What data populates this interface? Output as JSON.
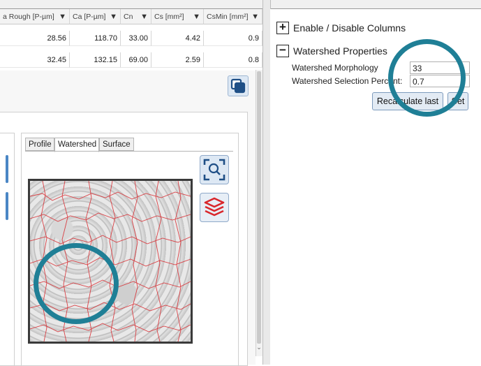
{
  "table": {
    "columns": [
      {
        "label": "a Rough [P-µm]"
      },
      {
        "label": "Ca [P-µm]"
      },
      {
        "label": "Cn"
      },
      {
        "label": "Cs [mm²]"
      },
      {
        "label": "CsMin [mm²]"
      }
    ],
    "rows": [
      [
        "28.56",
        "118.70",
        "33.00",
        "4.42",
        "0.9"
      ],
      [
        "32.45",
        "132.15",
        "69.00",
        "2.59",
        "0.8"
      ]
    ]
  },
  "viewer": {
    "tabs": [
      "Profile",
      "Watershed",
      "Surface"
    ],
    "active_tab": "Watershed"
  },
  "right_panel": {
    "enable_disable_label": "Enable / Disable Columns",
    "watershed_header": "Watershed Properties",
    "morphology_label": "Watershed Morphology",
    "morphology_value": "33",
    "selection_label": "Watershed Selection Percent:",
    "selection_value": "0.7",
    "recalculate_label": "Recalculate last",
    "set_label": "Set"
  },
  "colors": {
    "annotation_ring": "#1f7f96",
    "accent_button": "#e3ebf4",
    "watershed_lines": "#d9262b"
  },
  "icons": [
    "filter-icon",
    "copy-icon",
    "zoom-fit-icon",
    "layers-icon",
    "plus-icon",
    "minus-icon"
  ]
}
